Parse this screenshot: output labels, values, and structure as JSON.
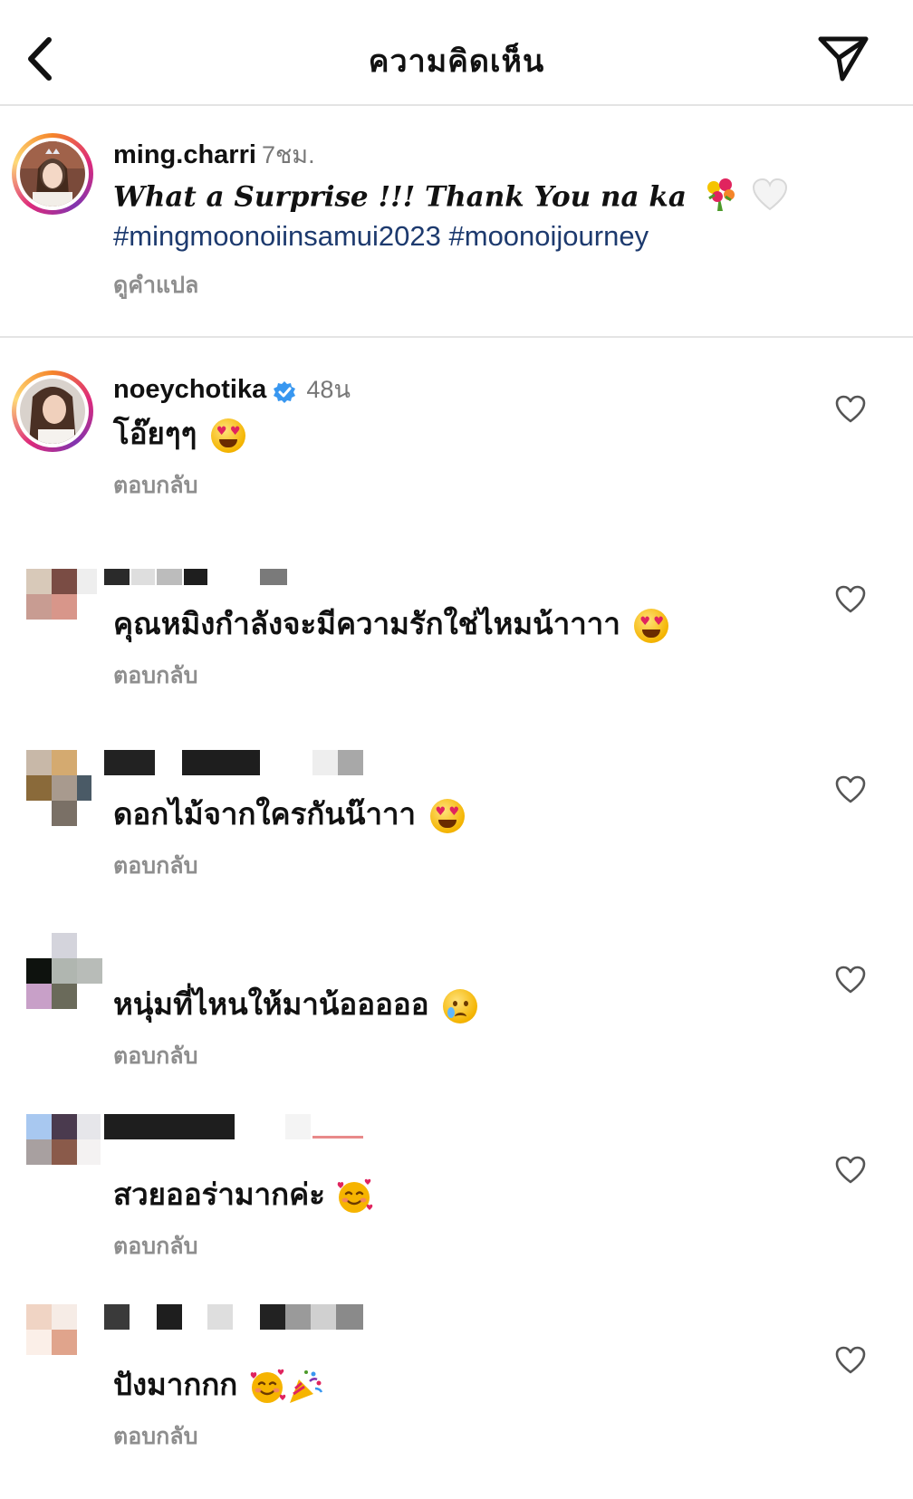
{
  "header": {
    "title": "ความคิดเห็น",
    "back_icon": "chevron-left-icon",
    "share_icon": "paper-plane-icon"
  },
  "caption": {
    "username": "ming.charri",
    "time": "7ชม.",
    "text": "What a Surprise !!! Thank You na ka",
    "emojis": [
      "bouquet-emoji",
      "white-heart-emoji"
    ],
    "hashtags": "#mingmoonoiinsamui2023 #moonoijourney",
    "see_translation": "ดูคำแปล"
  },
  "comments": [
    {
      "username": "noeychotika",
      "verified": true,
      "time": "48น",
      "text": "โอ๊ยๆๆ",
      "emoji": "heart-eyes-emoji",
      "reply": "ตอบกลับ"
    },
    {
      "username": "",
      "text": "คุณหมิงกำลังจะมีความรักใช่ไหมน้าาาา",
      "emoji": "heart-eyes-emoji",
      "reply": "ตอบกลับ"
    },
    {
      "username": "",
      "text": "ดอกไม้จากใครกันน๊าาา",
      "emoji": "heart-eyes-emoji",
      "reply": "ตอบกลับ"
    },
    {
      "username": "",
      "text": "หนุ่มที่ไหนให้มาน้อออออ",
      "emoji": "crying-face-emoji",
      "reply": "ตอบกลับ"
    },
    {
      "username": "",
      "text": "สวยออร่ามากค่ะ",
      "emoji": "smiling-face-with-hearts-emoji",
      "reply": "ตอบกลับ"
    },
    {
      "username": "",
      "text": "ปังมากกก",
      "emoji": "smiling-face-with-hearts-emoji",
      "emoji2": "party-popper-emoji",
      "reply": "ตอบกลับ"
    }
  ],
  "colors": {
    "hashtag": "#1d3a6e",
    "secondary_text": "#8e8e8e",
    "verified": "#3897f0",
    "divider": "#e4e4e4"
  }
}
